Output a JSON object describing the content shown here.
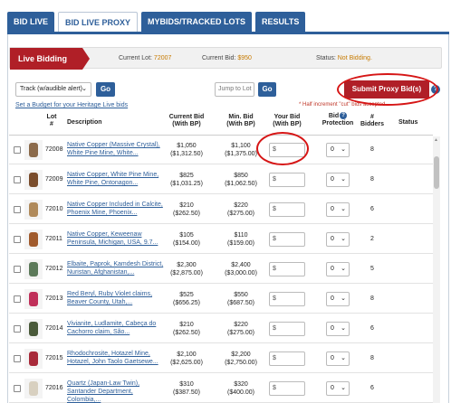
{
  "tabs": [
    "BID LIVE",
    "BID LIVE PROXY",
    "MYBIDS/TRACKED LOTS",
    "RESULTS"
  ],
  "live_bar": {
    "badge": "Live Bidding",
    "current_lot_label": "Current Lot:",
    "current_lot_value": "72007",
    "current_bid_label": "Current Bid:",
    "current_bid_value": "$950",
    "status_label": "Status:",
    "status_value": "Not Bidding."
  },
  "controls": {
    "track_select": "Track (w/audible alert)",
    "go_label": "Go",
    "jump_placeholder": "Jump to Lot",
    "jump_go_label": "Go",
    "submit_label": "Submit Proxy Bid(s)",
    "help_label": "?",
    "budget_link": "Set a Budget for your Heritage Live bids",
    "note": "* Half increment \"cut\" bids accepted."
  },
  "table_header": {
    "lot": "Lot\n#",
    "description": "Description",
    "current_bid": "Current Bid\n(With BP)",
    "min_bid": "Min. Bid\n(With BP)",
    "your_bid": "Your Bid\n(With BP)",
    "bid_protection": "Bid\nProtection",
    "bidders": "#\nBidders",
    "status": "Status"
  },
  "rows": [
    {
      "lot": "72008",
      "description": "Native Copper (Massive Crystal), White Pine Mine, White...",
      "current": "$1,050",
      "current_bp": "($1,312.50)",
      "min": "$1,100",
      "min_bp": "($1,375.00)",
      "your_bid": "$",
      "protection": "0",
      "bidders": "8",
      "thumb": "#8b6a4a"
    },
    {
      "lot": "72009",
      "description": "Native Copper, White Pine Mine, White Pine, Ontonagon...",
      "current": "$825",
      "current_bp": "($1,031.25)",
      "min": "$850",
      "min_bp": "($1,062.50)",
      "your_bid": "$",
      "protection": "0",
      "bidders": "8",
      "thumb": "#7a4d2c"
    },
    {
      "lot": "72010",
      "description": "Native Copper Included in Calcite, Phoenix Mine, Phoenix...",
      "current": "$210",
      "current_bp": "($262.50)",
      "min": "$220",
      "min_bp": "($275.00)",
      "your_bid": "$",
      "protection": "0",
      "bidders": "6",
      "thumb": "#b08a5b"
    },
    {
      "lot": "72011",
      "description": "Native Copper, Keweenaw Peninsula, Michigan, USA, 9.7...",
      "current": "$105",
      "current_bp": "($154.00)",
      "min": "$110",
      "min_bp": "($159.00)",
      "your_bid": "$",
      "protection": "0",
      "bidders": "2",
      "thumb": "#a05a2c"
    },
    {
      "lot": "72012",
      "description": "Elbaite, Paprok, Kamdesh District, Nuristan, Afghanistan,...",
      "current": "$2,300",
      "current_bp": "($2,875.00)",
      "min": "$2,400",
      "min_bp": "($3,000.00)",
      "your_bid": "$",
      "protection": "0",
      "bidders": "5",
      "thumb": "#5d7a5a"
    },
    {
      "lot": "72013",
      "description": "Red Beryl, Ruby Violet claims, Beaver County, Utah,...",
      "current": "$525",
      "current_bp": "($656.25)",
      "min": "$550",
      "min_bp": "($687.50)",
      "your_bid": "$",
      "protection": "0",
      "bidders": "8",
      "thumb": "#c0305a"
    },
    {
      "lot": "72014",
      "description": "Vivianite, Ludlamite, Cabeça do Cachorro claim, São...",
      "current": "$210",
      "current_bp": "($262.50)",
      "min": "$220",
      "min_bp": "($275.00)",
      "your_bid": "$",
      "protection": "0",
      "bidders": "6",
      "thumb": "#4a5a3a"
    },
    {
      "lot": "72015",
      "description": "Rhodochrosite, Hotazel Mine, Hotazel, John Taolo Gaetsewe...",
      "current": "$2,100",
      "current_bp": "($2,625.00)",
      "min": "$2,200",
      "min_bp": "($2,750.00)",
      "your_bid": "$",
      "protection": "0",
      "bidders": "8",
      "thumb": "#a82a3a"
    },
    {
      "lot": "72016",
      "description": "Quartz (Japan-Law Twin), Santander Department, Colombia,...",
      "current": "$310",
      "current_bp": "($387.50)",
      "min": "$320",
      "min_bp": "($400.00)",
      "your_bid": "$",
      "protection": "0",
      "bidders": "6",
      "thumb": "#d8d0c0"
    }
  ]
}
